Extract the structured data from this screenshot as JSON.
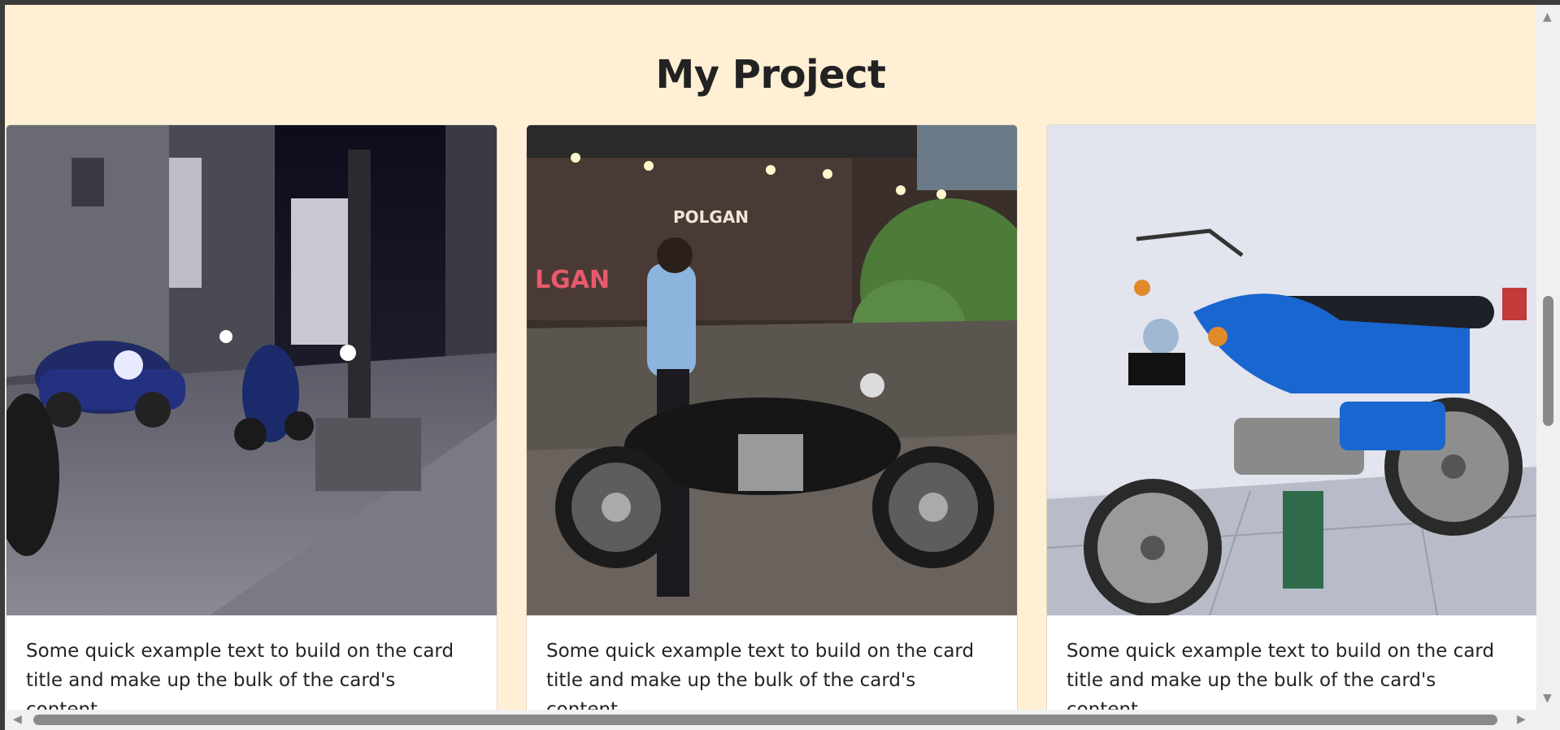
{
  "header": {
    "title": "My Project"
  },
  "cards": [
    {
      "image": "night-street-motorbikes-photo",
      "text": "Some quick example text to build on the card title and make up the bulk of the card's content."
    },
    {
      "image": "man-on-black-motorcycle-photo",
      "text": "Some quick example text to build on the card title and make up the bulk of the card's content."
    },
    {
      "image": "blue-vintage-motorcycle-photo",
      "text": "Some quick example text to build on the card title and make up the bulk of the card's content."
    }
  ],
  "colors": {
    "page_bg": "#fff0d5",
    "card_bg": "#ffffff",
    "text": "#212529"
  }
}
